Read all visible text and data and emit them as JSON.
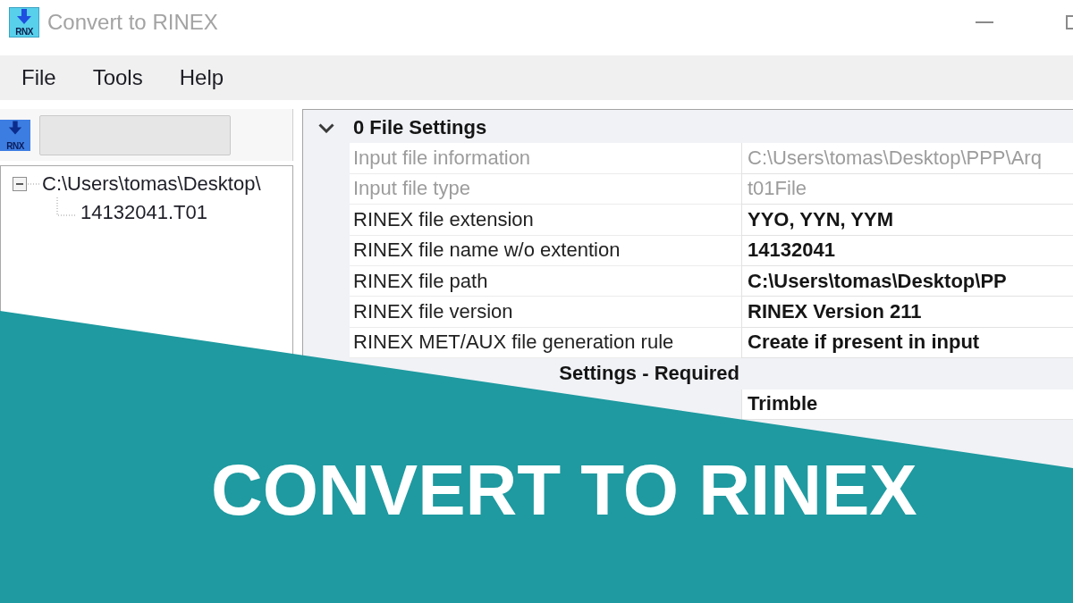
{
  "window": {
    "title": "Convert to RINEX",
    "logo_text": "RNX"
  },
  "menu": [
    {
      "label": "File"
    },
    {
      "label": "Tools"
    },
    {
      "label": "Help"
    }
  ],
  "toolbar": {
    "button_label": "RNX"
  },
  "tree": [
    {
      "label": "C:\\Users\\tomas\\Desktop\\",
      "expanded": true,
      "children": [
        {
          "label": "14132041.T01"
        }
      ]
    }
  ],
  "property_grid": {
    "categories": [
      {
        "title": "0 File Settings",
        "expanded": true,
        "rows": [
          {
            "label": "Input file information",
            "value": "C:\\Users\\tomas\\Desktop\\PPP\\Arq",
            "disabled": true,
            "modified": false
          },
          {
            "label": "Input file type",
            "value": "t01File",
            "disabled": true,
            "modified": false
          },
          {
            "label": "RINEX file extension",
            "value": "YYO, YYN, YYM",
            "disabled": false,
            "modified": true
          },
          {
            "label": "RINEX file name w/o extention",
            "value": "14132041",
            "disabled": false,
            "modified": true
          },
          {
            "label": "RINEX file path",
            "value": "C:\\Users\\tomas\\Desktop\\PP",
            "disabled": false,
            "modified": true
          },
          {
            "label": "RINEX file version",
            "value": "RINEX Version 211",
            "disabled": false,
            "modified": true
          },
          {
            "label": "RINEX MET/AUX file generation rule",
            "value": "Create if present in input",
            "disabled": false,
            "modified": true
          }
        ]
      },
      {
        "title": "Settings - Required",
        "rows": [
          {
            "value": "Trimble",
            "disabled": false,
            "modified": true
          }
        ]
      }
    ]
  },
  "banner": {
    "text": "CONVERT TO RINEX"
  }
}
